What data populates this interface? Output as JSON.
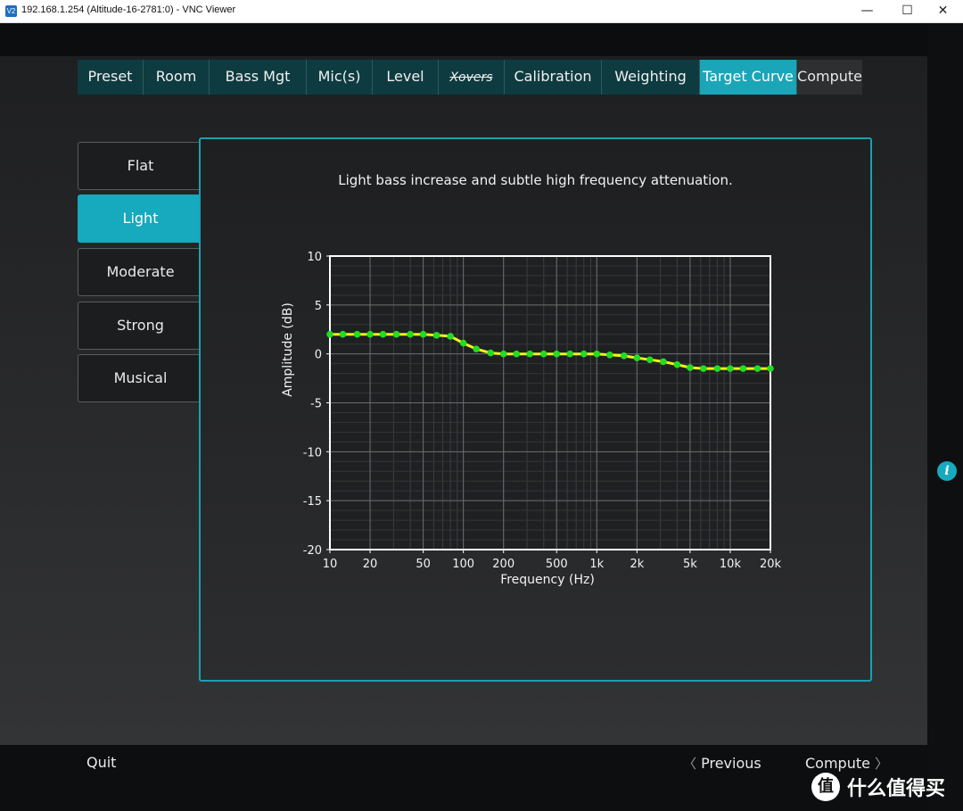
{
  "window": {
    "icon_text": "V2",
    "title": "192.168.1.254 (Altitude-16-2781:0) - VNC Viewer",
    "minimize": "—",
    "maximize": "☐",
    "close": "✕"
  },
  "tabs": [
    {
      "label": "Preset",
      "state": "normal"
    },
    {
      "label": "Room",
      "state": "normal"
    },
    {
      "label": "Bass Mgt",
      "state": "normal"
    },
    {
      "label": "Mic(s)",
      "state": "normal"
    },
    {
      "label": "Level",
      "state": "normal"
    },
    {
      "label": "Xovers",
      "state": "disabled"
    },
    {
      "label": "Calibration",
      "state": "normal"
    },
    {
      "label": "Weighting",
      "state": "normal"
    },
    {
      "label": "Target Curve",
      "state": "active"
    },
    {
      "label": "Compute",
      "state": "normal"
    }
  ],
  "presets": [
    {
      "label": "Flat",
      "active": false
    },
    {
      "label": "Light",
      "active": true
    },
    {
      "label": "Moderate",
      "active": false
    },
    {
      "label": "Strong",
      "active": false
    },
    {
      "label": "Musical",
      "active": false
    }
  ],
  "panel": {
    "description": "Light bass increase and subtle high frequency attenuation."
  },
  "chart_data": {
    "type": "line",
    "title": "",
    "xlabel": "Frequency (Hz)",
    "ylabel": "Amplitude (dB)",
    "x_scale": "log",
    "xlim": [
      10,
      20000
    ],
    "ylim": [
      -20,
      10
    ],
    "x_ticks": [
      10,
      20,
      50,
      100,
      200,
      500,
      1000,
      2000,
      5000,
      10000,
      20000
    ],
    "x_tick_labels": [
      "10",
      "20",
      "50",
      "100",
      "200",
      "500",
      "1k",
      "2k",
      "5k",
      "10k",
      "20k"
    ],
    "y_ticks": [
      10,
      5,
      0,
      -5,
      -10,
      -15,
      -20
    ],
    "grid": true,
    "series": [
      {
        "line_color": "#f2f21a",
        "marker_color": "#22dd22",
        "x": [
          10,
          12.5,
          16,
          20,
          25,
          31.5,
          40,
          50,
          63,
          80,
          100,
          125,
          160,
          200,
          250,
          315,
          400,
          500,
          630,
          800,
          1000,
          1250,
          1600,
          2000,
          2500,
          3150,
          4000,
          5000,
          6300,
          8000,
          10000,
          12500,
          16000,
          20000
        ],
        "y": [
          2,
          2,
          2,
          2,
          2,
          2,
          2,
          2,
          1.9,
          1.8,
          1.1,
          0.5,
          0.1,
          0,
          0,
          0,
          0,
          0,
          0,
          0,
          0,
          -0.1,
          -0.2,
          -0.4,
          -0.6,
          -0.8,
          -1.1,
          -1.4,
          -1.5,
          -1.5,
          -1.5,
          -1.5,
          -1.5,
          -1.5
        ]
      }
    ]
  },
  "bottom": {
    "quit": "Quit",
    "prev_chevron": "〈",
    "previous": "Previous",
    "compute": "Compute",
    "next_chevron": "〉"
  },
  "info_icon": "i",
  "watermark": {
    "logo": "值",
    "text": "什么值得买"
  }
}
